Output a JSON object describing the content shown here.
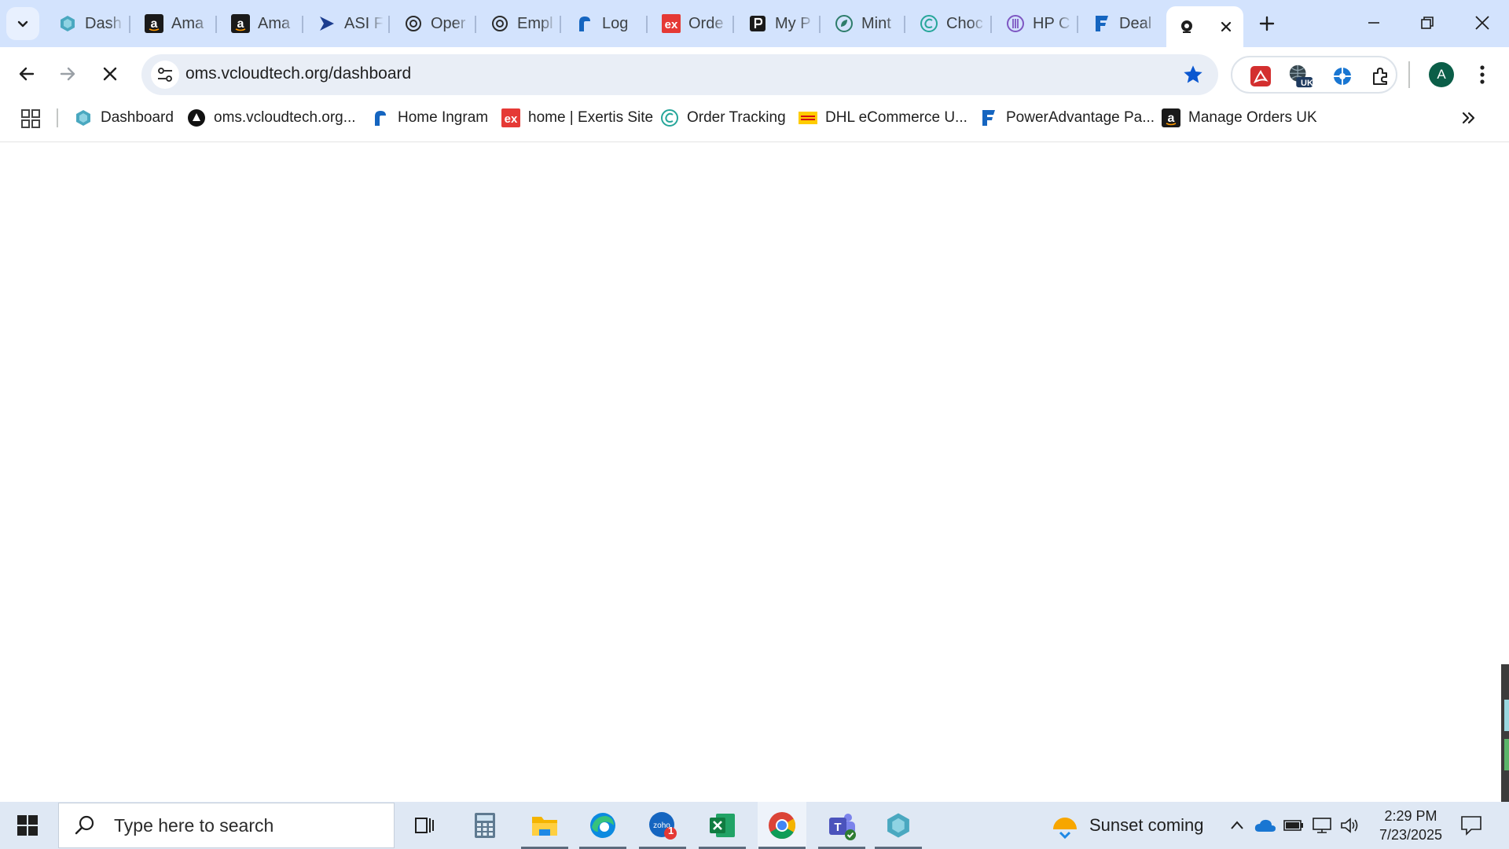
{
  "browser": {
    "tabs": [
      {
        "title": "Dash",
        "icon": "dashboard-hex-icon"
      },
      {
        "title": "Ama",
        "icon": "amazon-icon"
      },
      {
        "title": "Ama",
        "icon": "amazon-icon"
      },
      {
        "title": "ASI F",
        "icon": "asi-icon"
      },
      {
        "title": "Oper",
        "icon": "openai-icon"
      },
      {
        "title": "Empl",
        "icon": "openai-icon"
      },
      {
        "title": "Log",
        "icon": "ingram-icon"
      },
      {
        "title": "Orde",
        "icon": "exertis-icon"
      },
      {
        "title": "My P",
        "icon": "myp-icon"
      },
      {
        "title": "Mint",
        "icon": "mint-icon"
      },
      {
        "title": "Choc",
        "icon": "choc-icon"
      },
      {
        "title": "HP C",
        "icon": "hp-icon"
      },
      {
        "title": "Deal",
        "icon": "deal-icon"
      },
      {
        "title": "",
        "icon": "loading-globe-icon",
        "active": true
      }
    ],
    "url": "oms.vcloudtech.org/dashboard",
    "profile_initial": "A",
    "extensions": [
      {
        "name": "acrobat-extension-icon"
      },
      {
        "name": "vpn-uk-extension-icon",
        "badge": "UK"
      },
      {
        "name": "helper-extension-icon"
      },
      {
        "name": "puzzle-extensions-icon"
      }
    ],
    "bookmarks": [
      {
        "label": "Dashboard",
        "icon": "dashboard-hex-icon"
      },
      {
        "label": "oms.vcloudtech.org...",
        "icon": "oms-icon"
      },
      {
        "label": "Home Ingram",
        "icon": "ingram-icon"
      },
      {
        "label": "home | Exertis Site",
        "icon": "exertis-icon"
      },
      {
        "label": "Order Tracking",
        "icon": "choc-icon"
      },
      {
        "label": "DHL eCommerce U...",
        "icon": "dhl-icon"
      },
      {
        "label": "PowerAdvantage Pa...",
        "icon": "poweradvantage-icon"
      },
      {
        "label": "Manage Orders UK",
        "icon": "amazon-icon"
      }
    ]
  },
  "taskbar": {
    "search_placeholder": "Type here to search",
    "apps": [
      {
        "name": "task-view-icon"
      },
      {
        "name": "calculator-icon"
      },
      {
        "name": "file-explorer-icon"
      },
      {
        "name": "edge-icon"
      },
      {
        "name": "zoho-icon",
        "badge": "1"
      },
      {
        "name": "excel-icon"
      },
      {
        "name": "chrome-icon"
      },
      {
        "name": "teams-icon"
      },
      {
        "name": "dashboard-hex-icon"
      }
    ],
    "weather": "Sunset coming",
    "time": "2:29 PM",
    "date": "7/23/2025"
  },
  "colors": {
    "tabstrip": "#d3e3fd",
    "omnibox": "#e9eef6",
    "accent_star": "#0b57d0",
    "taskbar": "#dfe8f4"
  }
}
